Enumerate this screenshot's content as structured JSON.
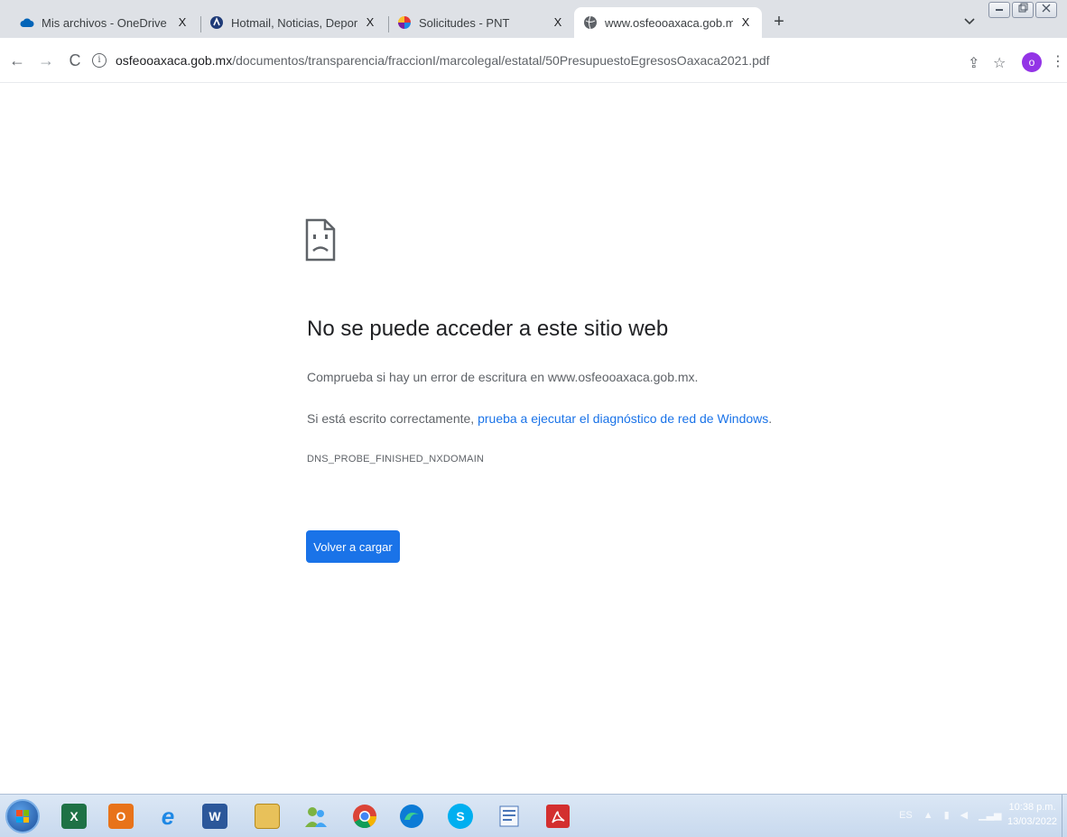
{
  "tabs": [
    {
      "title": "Mis archivos - OneDrive",
      "icon": "onedrive-cloud-icon",
      "close": "X"
    },
    {
      "title": "Hotmail, Noticias, Deportes y Ent",
      "icon": "msn-icon",
      "close": "X"
    },
    {
      "title": "Solicitudes - PNT",
      "icon": "pnt-icon",
      "close": "X"
    },
    {
      "title": "www.osfeooaxaca.gob.mx",
      "icon": "globe-icon",
      "close": "X",
      "active": true
    }
  ],
  "new_tab": "+",
  "toolbar": {
    "back": "←",
    "forward": "→",
    "reload": "C",
    "url_host": "osfeooaxaca.gob.mx",
    "url_path": "/documentos/transparencia/fraccionI/marcolegal/estatal/50PresupuestoEgresosOaxaca2021.pdf",
    "info": "i",
    "share": "⇪",
    "bookmark": "☆",
    "profile_initial": "o",
    "menu": "⋮"
  },
  "error": {
    "title": "No se puede acceder a este sitio web",
    "line1": "Comprueba si hay un error de escritura en www.osfeooaxaca.gob.mx.",
    "line2_prefix": "Si está escrito correctamente, ",
    "line2_link": "prueba a ejecutar el diagnóstico de red de Windows",
    "line2_suffix": ".",
    "code": "DNS_PROBE_FINISHED_NXDOMAIN",
    "reload_button": "Volver a cargar"
  },
  "taskbar": {
    "apps": [
      {
        "name": "excel",
        "icon": "excel-icon",
        "label": "X",
        "color": "#1e7145"
      },
      {
        "name": "outlook",
        "icon": "outlook-icon",
        "label": "O",
        "color": "#e8731a"
      },
      {
        "name": "internet-explorer",
        "icon": "ie-icon",
        "label": "e",
        "color": "#1e88e5"
      },
      {
        "name": "word",
        "icon": "word-icon",
        "label": "W",
        "color": "#2b579a"
      },
      {
        "name": "file-explorer",
        "icon": "folder-icon",
        "label": "",
        "color": "#e8c15a"
      },
      {
        "name": "contacts",
        "icon": "contacts-icon",
        "label": "",
        "color": "#7cb342"
      },
      {
        "name": "chrome",
        "icon": "chrome-icon",
        "label": "",
        "color": "#db4437"
      },
      {
        "name": "edge",
        "icon": "edge-icon",
        "label": "",
        "color": "#0c7bd6"
      },
      {
        "name": "skype",
        "icon": "skype-icon",
        "label": "S",
        "color": "#00aff0"
      },
      {
        "name": "wordpad",
        "icon": "wordpad-icon",
        "label": "",
        "color": "#4a76b8"
      },
      {
        "name": "acrobat",
        "icon": "acrobat-icon",
        "label": "",
        "color": "#d32f2f"
      }
    ],
    "language": "ES",
    "time": "10:38 p.m.",
    "date": "13/03/2022"
  }
}
